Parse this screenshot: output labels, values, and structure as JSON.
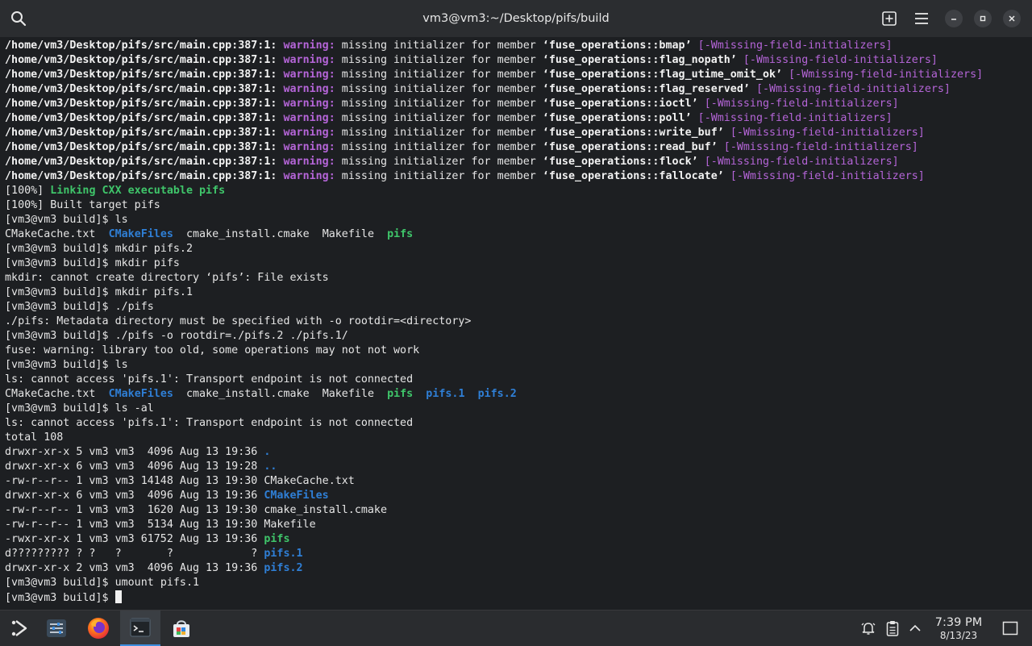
{
  "window": {
    "title": "vm3@vm3:~/Desktop/pifs/build"
  },
  "terminal": {
    "warnings": [
      {
        "path": "/home/vm3/Desktop/pifs/src/main.cpp:387:1:",
        "label": "warning:",
        "text": " missing initializer for member ",
        "member": "‘fuse_operations::bmap’",
        "flag": "[-Wmissing-field-initializers]"
      },
      {
        "path": "/home/vm3/Desktop/pifs/src/main.cpp:387:1:",
        "label": "warning:",
        "text": " missing initializer for member ",
        "member": "‘fuse_operations::flag_nopath’",
        "flag": "[-Wmissing-field-initializers]"
      },
      {
        "path": "/home/vm3/Desktop/pifs/src/main.cpp:387:1:",
        "label": "warning:",
        "text": " missing initializer for member ",
        "member": "‘fuse_operations::flag_utime_omit_ok’",
        "flag": "[-Wmissing-field-initializers]"
      },
      {
        "path": "/home/vm3/Desktop/pifs/src/main.cpp:387:1:",
        "label": "warning:",
        "text": " missing initializer for member ",
        "member": "‘fuse_operations::flag_reserved’",
        "flag": "[-Wmissing-field-initializers]"
      },
      {
        "path": "/home/vm3/Desktop/pifs/src/main.cpp:387:1:",
        "label": "warning:",
        "text": " missing initializer for member ",
        "member": "‘fuse_operations::ioctl’",
        "flag": "[-Wmissing-field-initializers]"
      },
      {
        "path": "/home/vm3/Desktop/pifs/src/main.cpp:387:1:",
        "label": "warning:",
        "text": " missing initializer for member ",
        "member": "‘fuse_operations::poll’",
        "flag": "[-Wmissing-field-initializers]"
      },
      {
        "path": "/home/vm3/Desktop/pifs/src/main.cpp:387:1:",
        "label": "warning:",
        "text": " missing initializer for member ",
        "member": "‘fuse_operations::write_buf’",
        "flag": "[-Wmissing-field-initializers]"
      },
      {
        "path": "/home/vm3/Desktop/pifs/src/main.cpp:387:1:",
        "label": "warning:",
        "text": " missing initializer for member ",
        "member": "‘fuse_operations::read_buf’",
        "flag": "[-Wmissing-field-initializers]"
      },
      {
        "path": "/home/vm3/Desktop/pifs/src/main.cpp:387:1:",
        "label": "warning:",
        "text": " missing initializer for member ",
        "member": "‘fuse_operations::flock’",
        "flag": "[-Wmissing-field-initializers]"
      },
      {
        "path": "/home/vm3/Desktop/pifs/src/main.cpp:387:1:",
        "label": "warning:",
        "text": " missing initializer for member ",
        "member": "‘fuse_operations::fallocate’",
        "flag": "[-Wmissing-field-initializers]"
      }
    ],
    "link": {
      "prefix": "[100%] ",
      "text": "Linking CXX executable pifs"
    },
    "built": "[100%] Built target pifs",
    "prompt": "[vm3@vm3 build]$ ",
    "cmd_ls1": "ls",
    "ls1": {
      "f1": "CMakeCache.txt",
      "d1": "CMakeFiles",
      "f2": "cmake_install.cmake",
      "f3": "Makefile",
      "x1": "pifs"
    },
    "cmd_mkdir1": "mkdir pifs.2",
    "cmd_mkdir2": "mkdir pifs",
    "mkdir_err": "mkdir: cannot create directory ‘pifs’: File exists",
    "cmd_mkdir3": "mkdir pifs.1",
    "cmd_run1": "./pifs",
    "run1_out": "./pifs: Metadata directory must be specified with -o rootdir=<directory>",
    "cmd_run2": "./pifs -o rootdir=./pifs.2 ./pifs.1/",
    "run2_out": "fuse: warning: library too old, some operations may not not work",
    "cmd_ls2": "ls",
    "ls2_err": "ls: cannot access 'pifs.1': Transport endpoint is not connected",
    "ls2": {
      "f1": "CMakeCache.txt",
      "d1": "CMakeFiles",
      "f2": "cmake_install.cmake",
      "f3": "Makefile",
      "x1": "pifs",
      "d2": "pifs.1",
      "d3": "pifs.2"
    },
    "cmd_ls3": "ls -al",
    "ls3_err": "ls: cannot access 'pifs.1': Transport endpoint is not connected",
    "total": "total 108",
    "listing": [
      {
        "meta": "drwxr-xr-x 5 vm3 vm3  4096 Aug 13 19:36 ",
        "name": "."
      },
      {
        "meta": "drwxr-xr-x 6 vm3 vm3  4096 Aug 13 19:28 ",
        "name": ".."
      },
      {
        "meta": "-rw-r--r-- 1 vm3 vm3 14148 Aug 13 19:30 ",
        "name": "CMakeCache.txt"
      },
      {
        "meta": "drwxr-xr-x 6 vm3 vm3  4096 Aug 13 19:36 ",
        "name": "CMakeFiles"
      },
      {
        "meta": "-rw-r--r-- 1 vm3 vm3  1620 Aug 13 19:30 ",
        "name": "cmake_install.cmake"
      },
      {
        "meta": "-rw-r--r-- 1 vm3 vm3  5134 Aug 13 19:30 ",
        "name": "Makefile"
      },
      {
        "meta": "-rwxr-xr-x 1 vm3 vm3 61752 Aug 13 19:36 ",
        "name": "pifs"
      },
      {
        "meta": "d????????? ? ?   ?       ?            ? ",
        "name": "pifs.1"
      },
      {
        "meta": "drwxr-xr-x 2 vm3 vm3  4096 Aug 13 19:36 ",
        "name": "pifs.2"
      }
    ],
    "cmd_umount": "umount pifs.1"
  },
  "taskbar": {
    "time": "7:39 PM",
    "date": "8/13/23"
  },
  "colors": {
    "background": "#1d1f22",
    "warning": "#b565d8",
    "executable": "#3fc56a",
    "directory": "#2f7fd6"
  }
}
